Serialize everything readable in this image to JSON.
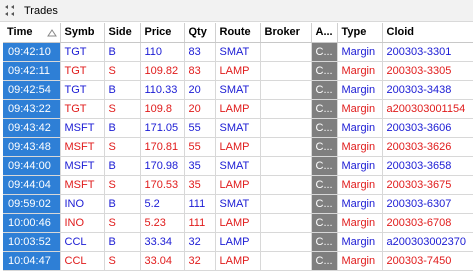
{
  "window": {
    "title": "Trades"
  },
  "columns": [
    "Time",
    "Symb",
    "Side",
    "Price",
    "Qty",
    "Route",
    "Broker",
    "A...",
    "Type",
    "Cloid"
  ],
  "colors": {
    "buy": "#1b1bd4",
    "sell": "#e01b1b",
    "time_bg": "#2e7fd6",
    "account_bg": "#7f7f7f"
  },
  "rows": [
    {
      "time": "09:42:10",
      "symb": "TGT",
      "side": "B",
      "price": "110",
      "qty": "83",
      "route": "SMAT",
      "broker": "",
      "acct": "C...",
      "type": "Margin",
      "cloid": "200303-3301"
    },
    {
      "time": "09:42:11",
      "symb": "TGT",
      "side": "S",
      "price": "109.82",
      "qty": "83",
      "route": "LAMP",
      "broker": "",
      "acct": "C...",
      "type": "Margin",
      "cloid": "200303-3305"
    },
    {
      "time": "09:42:54",
      "symb": "TGT",
      "side": "B",
      "price": "110.33",
      "qty": "20",
      "route": "SMAT",
      "broker": "",
      "acct": "C...",
      "type": "Margin",
      "cloid": "200303-3438"
    },
    {
      "time": "09:43:22",
      "symb": "TGT",
      "side": "S",
      "price": "109.8",
      "qty": "20",
      "route": "LAMP",
      "broker": "",
      "acct": "C...",
      "type": "Margin",
      "cloid": "a200303001154"
    },
    {
      "time": "09:43:42",
      "symb": "MSFT",
      "side": "B",
      "price": "171.05",
      "qty": "55",
      "route": "SMAT",
      "broker": "",
      "acct": "C...",
      "type": "Margin",
      "cloid": "200303-3606"
    },
    {
      "time": "09:43:48",
      "symb": "MSFT",
      "side": "S",
      "price": "170.81",
      "qty": "55",
      "route": "LAMP",
      "broker": "",
      "acct": "C...",
      "type": "Margin",
      "cloid": "200303-3626"
    },
    {
      "time": "09:44:00",
      "symb": "MSFT",
      "side": "B",
      "price": "170.98",
      "qty": "35",
      "route": "SMAT",
      "broker": "",
      "acct": "C...",
      "type": "Margin",
      "cloid": "200303-3658"
    },
    {
      "time": "09:44:04",
      "symb": "MSFT",
      "side": "S",
      "price": "170.53",
      "qty": "35",
      "route": "LAMP",
      "broker": "",
      "acct": "C...",
      "type": "Margin",
      "cloid": "200303-3675"
    },
    {
      "time": "09:59:02",
      "symb": "INO",
      "side": "B",
      "price": "5.2",
      "qty": "111",
      "route": "SMAT",
      "broker": "",
      "acct": "C...",
      "type": "Margin",
      "cloid": "200303-6307"
    },
    {
      "time": "10:00:46",
      "symb": "INO",
      "side": "S",
      "price": "5.23",
      "qty": "111",
      "route": "LAMP",
      "broker": "",
      "acct": "C...",
      "type": "Margin",
      "cloid": "200303-6708"
    },
    {
      "time": "10:03:52",
      "symb": "CCL",
      "side": "B",
      "price": "33.34",
      "qty": "32",
      "route": "LAMP",
      "broker": "",
      "acct": "C...",
      "type": "Margin",
      "cloid": "a200303002370"
    },
    {
      "time": "10:04:47",
      "symb": "CCL",
      "side": "S",
      "price": "33.04",
      "qty": "32",
      "route": "LAMP",
      "broker": "",
      "acct": "C...",
      "type": "Margin",
      "cloid": "200303-7450"
    }
  ]
}
